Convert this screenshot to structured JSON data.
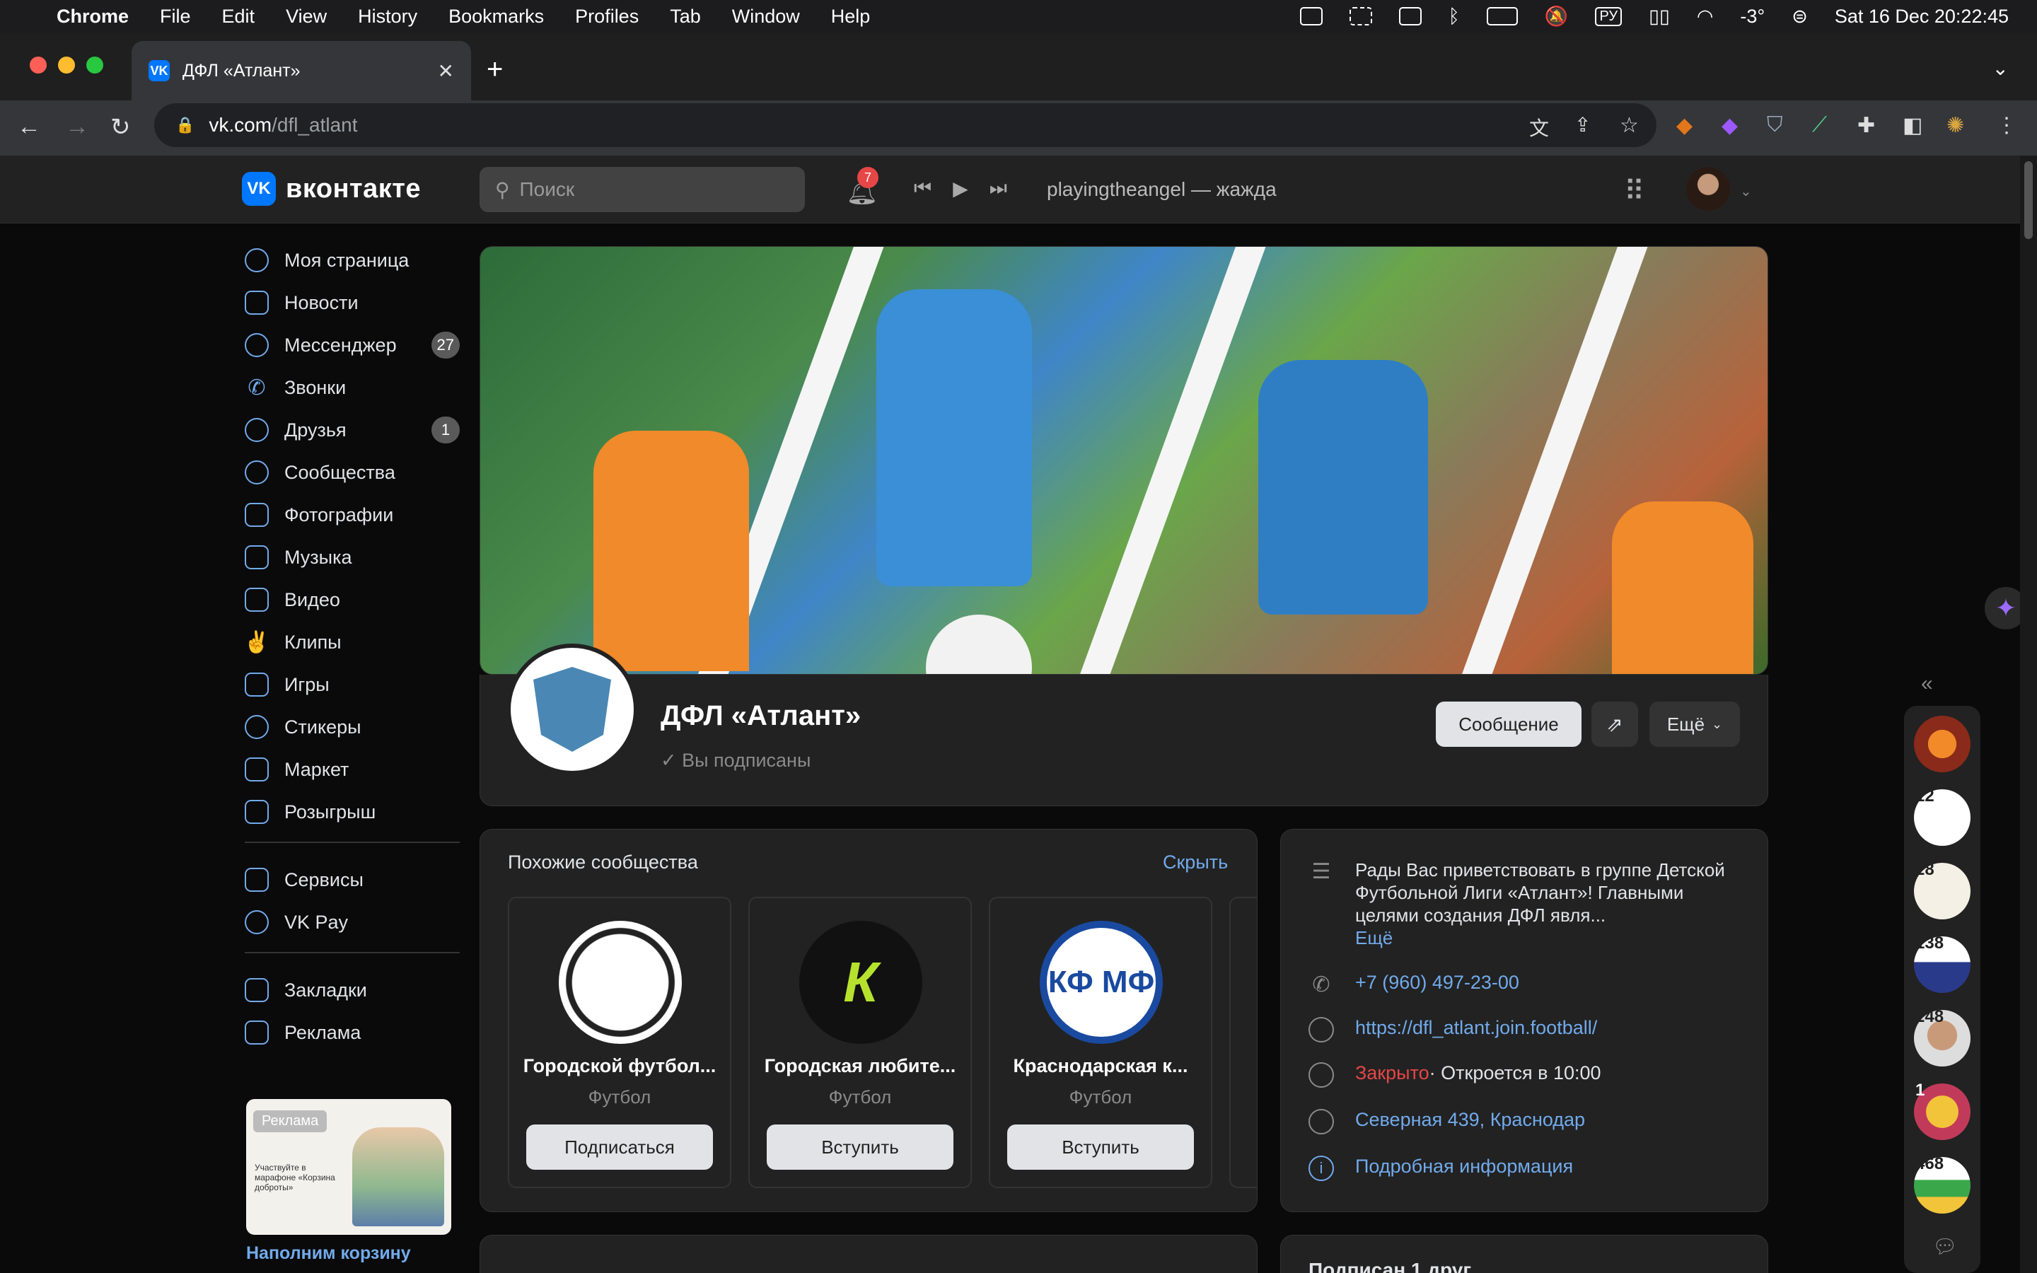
{
  "menubar": {
    "app": "Chrome",
    "items": [
      "File",
      "Edit",
      "View",
      "History",
      "Bookmarks",
      "Profiles",
      "Tab",
      "Window",
      "Help"
    ],
    "keyboard_layout": "РУ",
    "temperature": "-3°",
    "datetime": "Sat 16 Dec  20:22:45"
  },
  "browser": {
    "tab_title": "ДФЛ «Атлант»",
    "tab_favicon": "VK",
    "url_host": "vk.com",
    "url_path": "/dfl_atlant"
  },
  "vk": {
    "logo_text": "вконтакте",
    "logo_mark": "VK",
    "search_placeholder": "Поиск",
    "notifications_count": "7",
    "now_playing": "playingtheangel — жажда"
  },
  "sidebar": {
    "items": [
      {
        "label": "Моя страница",
        "icon": "user-circle-icon"
      },
      {
        "label": "Новости",
        "icon": "news-icon"
      },
      {
        "label": "Мессенджер",
        "icon": "chat-icon",
        "badge": "27"
      },
      {
        "label": "Звонки",
        "icon": "phone-icon"
      },
      {
        "label": "Друзья",
        "icon": "friends-icon",
        "badge": "1"
      },
      {
        "label": "Сообщества",
        "icon": "communities-icon"
      },
      {
        "label": "Фотографии",
        "icon": "photo-icon"
      },
      {
        "label": "Музыка",
        "icon": "music-icon"
      },
      {
        "label": "Видео",
        "icon": "video-icon"
      },
      {
        "label": "Клипы",
        "icon": "clips-icon"
      },
      {
        "label": "Игры",
        "icon": "gamepad-icon"
      },
      {
        "label": "Стикеры",
        "icon": "sticker-icon"
      },
      {
        "label": "Маркет",
        "icon": "market-icon"
      },
      {
        "label": "Розыгрыш",
        "icon": "gift-icon"
      }
    ],
    "items2": [
      {
        "label": "Сервисы",
        "icon": "services-icon"
      },
      {
        "label": "VK Pay",
        "icon": "vkpay-icon"
      }
    ],
    "items3": [
      {
        "label": "Закладки",
        "icon": "bookmark-icon"
      },
      {
        "label": "Реклама",
        "icon": "megaphone-icon"
      }
    ],
    "ad_label": "Реклама",
    "ad_text": "Участвуйте в марафоне «Корзина доброты»",
    "ad_title": "Наполним корзину"
  },
  "group": {
    "name": "ДФЛ «Атлант»",
    "subscribed": "Вы подписаны",
    "message_btn": "Сообщение",
    "more_btn": "Ещё"
  },
  "similar": {
    "title": "Похожие сообщества",
    "hide": "Скрыть",
    "cards": [
      {
        "name": "Городской футбол...",
        "category": "Футбол",
        "button": "Подписаться"
      },
      {
        "name": "Городская любите...",
        "category": "Футбол",
        "button": "Вступить"
      },
      {
        "name": "Краснодарская к...",
        "category": "Футбол",
        "button": "Вступить",
        "logo_text": "КФ МФ"
      }
    ]
  },
  "info": {
    "description": "Рады Вас приветствовать в группе Детской Футбольной Лиги «Атлант»! Главными целями создания ДФЛ явля...",
    "more": "Ещё",
    "phone": "+7 (960) 497-23-00",
    "site": "https://dfl_atlant.join.football/",
    "status_closed": "Закрыто",
    "status_opens": " · Откроется в 10:00",
    "address": "Северная 439, Краснодар",
    "details": "Подробная информация",
    "friends_header": "Подписан 1 друг"
  },
  "rail_chats": [
    {
      "count": ""
    },
    {
      "count": "12"
    },
    {
      "count": "28"
    },
    {
      "count": "138"
    },
    {
      "count": "248"
    },
    {
      "count": "1"
    },
    {
      "count": "468"
    }
  ],
  "colors": {
    "accent": "#71aaeb",
    "brand": "#0077ff",
    "closed": "#e64646"
  }
}
